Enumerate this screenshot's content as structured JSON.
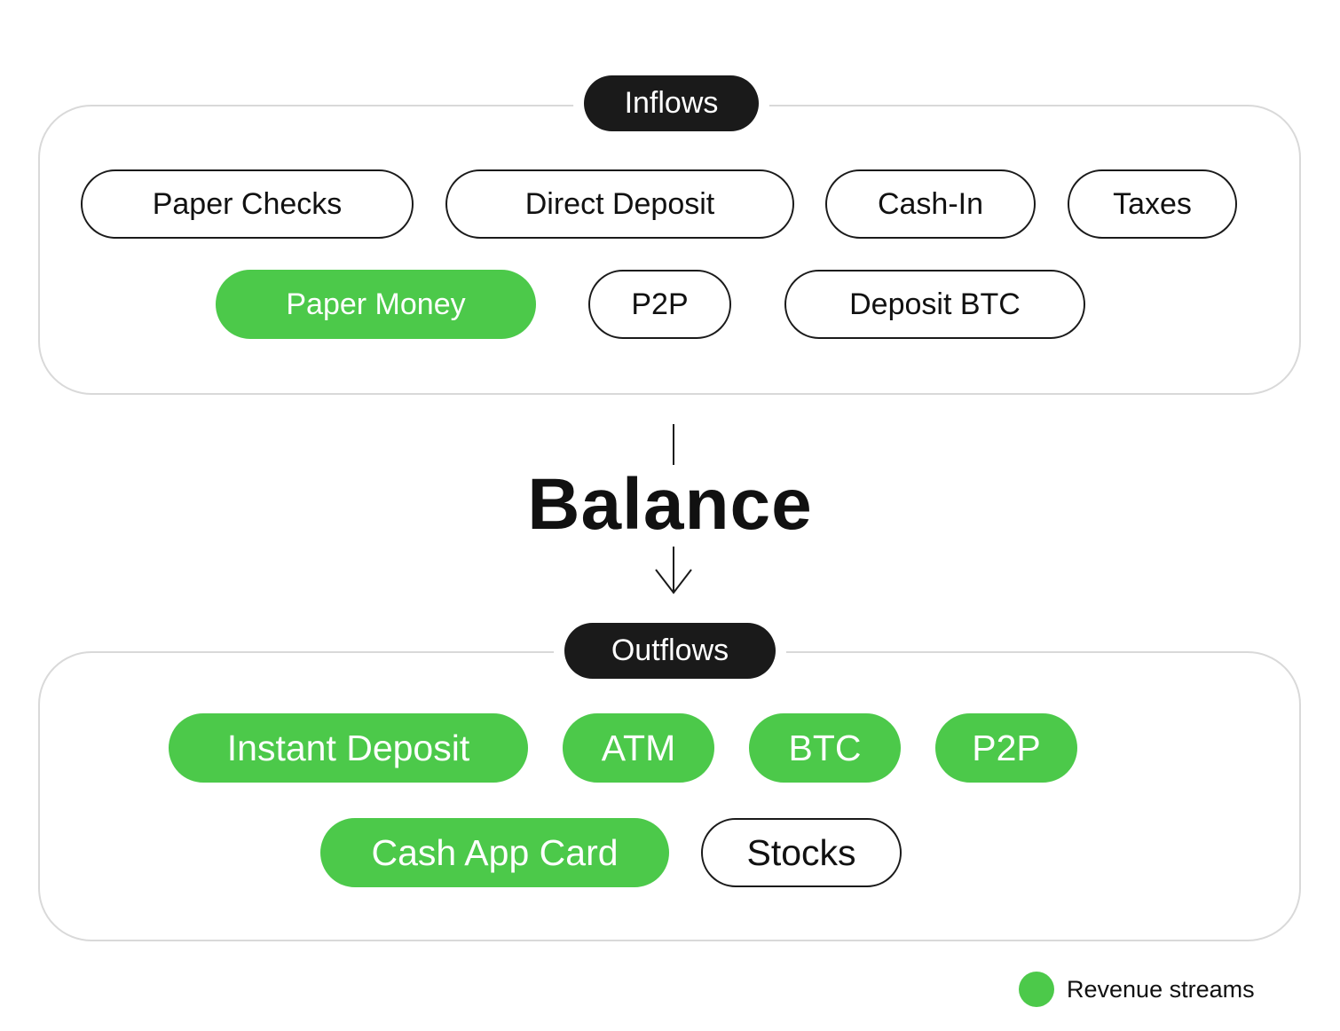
{
  "colors": {
    "revenue": "#4cc94a",
    "label_bg": "#1a1a1a",
    "border": "#d9d9d9"
  },
  "inflows": {
    "title": "Inflows",
    "items": [
      {
        "label": "Paper Checks",
        "revenue": false
      },
      {
        "label": "Direct Deposit",
        "revenue": false
      },
      {
        "label": "Cash-In",
        "revenue": false
      },
      {
        "label": "Taxes",
        "revenue": false
      },
      {
        "label": "Paper Money",
        "revenue": true
      },
      {
        "label": "P2P",
        "revenue": false
      },
      {
        "label": "Deposit BTC",
        "revenue": false
      }
    ]
  },
  "balance": {
    "title": "Balance"
  },
  "outflows": {
    "title": "Outflows",
    "items": [
      {
        "label": "Instant Deposit",
        "revenue": true
      },
      {
        "label": "ATM",
        "revenue": true
      },
      {
        "label": "BTC",
        "revenue": true
      },
      {
        "label": "P2P",
        "revenue": true
      },
      {
        "label": "Cash App Card",
        "revenue": true
      },
      {
        "label": "Stocks",
        "revenue": false
      }
    ]
  },
  "legend": {
    "label": "Revenue streams",
    "icon": "green-dot"
  }
}
